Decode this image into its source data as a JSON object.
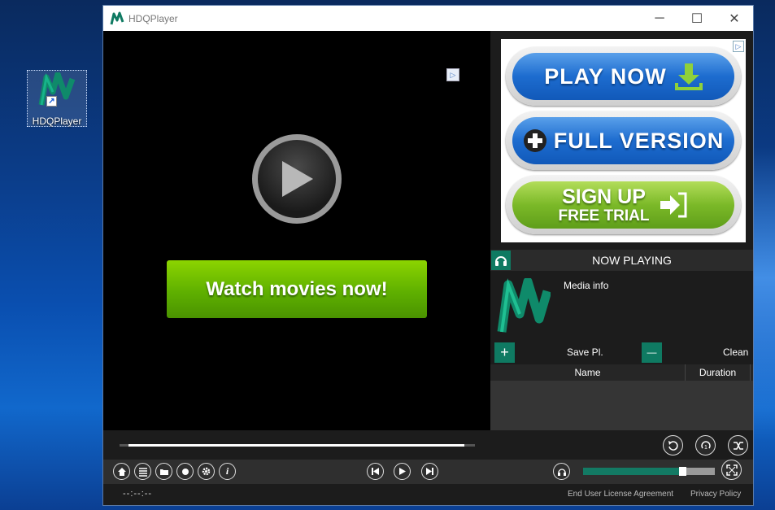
{
  "desktop": {
    "icon_label": "HDQPlayer"
  },
  "window": {
    "title": "HDQPlayer",
    "minimize": "─",
    "maximize": "☐",
    "close": "✕"
  },
  "video_area": {
    "ad_button": "Watch movies now!"
  },
  "side_ad": {
    "play_now": "PLAY NOW",
    "full_version": "FULL VERSION",
    "sign_up": "SIGN UP",
    "free_trial": "FREE TRIAL"
  },
  "now_playing": {
    "header": "NOW PLAYING",
    "media_info": "Media info"
  },
  "playlist_tools": {
    "add_icon": "+",
    "save_label": "Save Pl.",
    "remove_icon": "—",
    "clean_label": "Clean"
  },
  "playlist": {
    "columns": [
      "Name",
      "Duration"
    ]
  },
  "playback": {
    "seek_progress": 0.97,
    "volume": 0.75
  },
  "status": {
    "time": "--:--:--",
    "eula": "End User License Agreement",
    "privacy": "Privacy Policy"
  },
  "colors": {
    "accent": "#0f7a62",
    "ad_green": "#5fb000",
    "ad_blue": "#1d6ccf"
  }
}
